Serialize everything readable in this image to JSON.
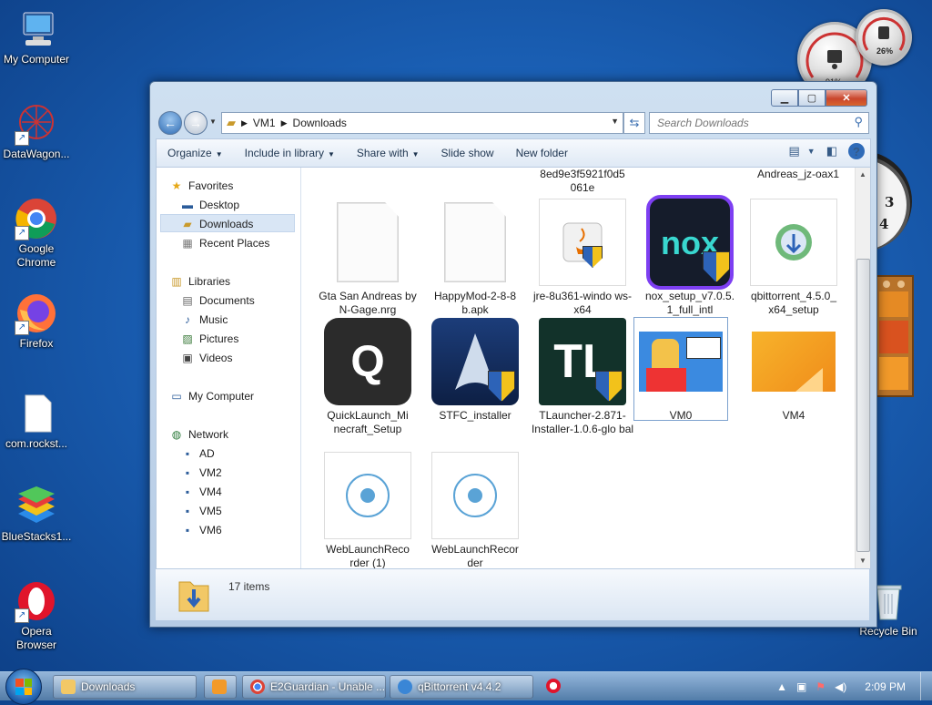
{
  "desktop": {
    "icons": [
      {
        "label": "My Computer"
      },
      {
        "label": "DataWagon..."
      },
      {
        "label": "Google Chrome"
      },
      {
        "label": "Firefox"
      },
      {
        "label": "com.rockst..."
      },
      {
        "label": "BlueStacks1..."
      },
      {
        "label": "Opera Browser"
      },
      {
        "label": "Recycle Bin"
      }
    ],
    "gadgets": {
      "cpu_meter_a": "91%",
      "cpu_meter_b": "26%"
    }
  },
  "window": {
    "breadcrumb": [
      "VM1",
      "Downloads"
    ],
    "search_placeholder": "Search Downloads",
    "toolbar": {
      "organize": "Organize",
      "include": "Include in library",
      "share": "Share with",
      "slideshow": "Slide show",
      "newfolder": "New folder"
    },
    "nav": {
      "favorites": "Favorites",
      "desktop": "Desktop",
      "downloads": "Downloads",
      "recent": "Recent Places",
      "libraries": "Libraries",
      "documents": "Documents",
      "music": "Music",
      "pictures": "Pictures",
      "videos": "Videos",
      "mycomputer": "My Computer",
      "network": "Network",
      "net_items": [
        "AD",
        "VM2",
        "VM4",
        "VM5",
        "VM6"
      ]
    },
    "files": {
      "top_partial_1": "8ed9e3f5921f0d5 061e",
      "top_partial_2": "Andreas_jz-oax1",
      "items": [
        "Gta San Andreas by N-Gage.nrg",
        "HappyMod-2-8-8 b.apk",
        "jre-8u361-windo ws-x64",
        "nox_setup_v7.0.5. 1_full_intl",
        "qbittorrent_4.5.0_ x64_setup",
        "QuickLaunch_Mi necraft_Setup",
        "STFC_installer",
        "TLauncher-2.871- Installer-1.0.6-glo bal",
        "VM0",
        "VM4",
        "WebLaunchReco rder (1)",
        "WebLaunchRecor der"
      ]
    },
    "status": {
      "count": "17 items"
    }
  },
  "taskbar": {
    "tasks": [
      "Downloads",
      "E2Guardian - Unable ...",
      "qBittorrent v4.4.2"
    ],
    "time": "2:09 PM"
  },
  "colors": {
    "accent": "#1a5fb4",
    "selection": "#d9e6f5",
    "close": "#c9452c"
  }
}
